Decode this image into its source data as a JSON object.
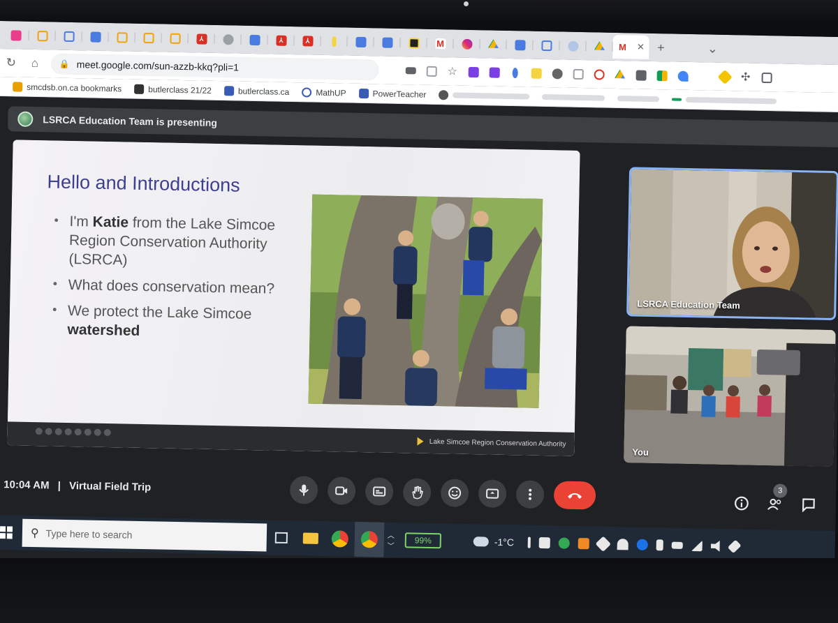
{
  "browser": {
    "url": "meet.google.com/sun-azzb-kkq?pli=1",
    "bookmarks": [
      {
        "label": "smcdsb.on.ca bookmarks",
        "color": "#e6a000"
      },
      {
        "label": "butlerclass 21/22",
        "color": "#333333"
      },
      {
        "label": "butlerclass.ca",
        "color": "#3a5bb5"
      },
      {
        "label": "MathUP",
        "color": "#3a5bb5"
      },
      {
        "label": "PowerTeacher",
        "color": "#3a5bb5"
      }
    ]
  },
  "meet": {
    "presenting_text": "LSRCA Education Team is presenting",
    "time": "10:04 AM",
    "separator": "|",
    "meeting_title": "Virtual Field Trip",
    "participant_count": "3",
    "tiles": [
      {
        "label": "LSRCA Education Team"
      },
      {
        "label": "You"
      }
    ]
  },
  "slide": {
    "title": "Hello and Introductions",
    "bullets": [
      {
        "prefix": "I'm ",
        "bold": "Katie",
        "suffix": " from the Lake Simcoe Region Conservation Authority (LSRCA)"
      },
      {
        "prefix": "What does conservation mean?",
        "bold": "",
        "suffix": ""
      },
      {
        "prefix": "We protect the Lake Simcoe ",
        "bold": "watershed",
        "suffix": ""
      }
    ],
    "footer": "Lake Simcoe Region Conservation Authority"
  },
  "taskbar": {
    "search_placeholder": "Type here to search",
    "battery": "99%",
    "temperature": "-1°C"
  },
  "colors": {
    "accent_blue": "#8ab4f8",
    "end_call_red": "#ea4335",
    "slide_title": "#3d3f8f",
    "battery_green": "#7ed36b"
  }
}
